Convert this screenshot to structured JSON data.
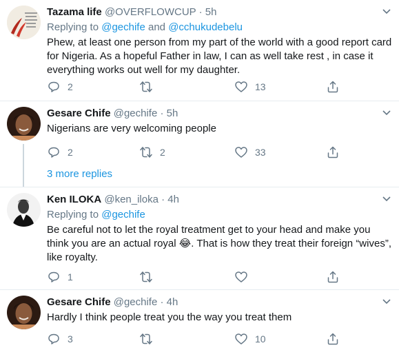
{
  "tweets": [
    {
      "name": "Tazama life",
      "handle": "@OVERFLOWCUP",
      "time": "5h",
      "replying_prefix": "Replying to ",
      "replying_mention_1": "@gechife",
      "replying_and": " and ",
      "replying_mention_2": "@cchukudebelu",
      "text_lines": [
        "Phew, at least one person from my part of the world with a good report card",
        "for Nigeria. As a hopeful Father in law, I can as well take rest , in case  it",
        "everything works out well for my daughter."
      ],
      "replies": "2",
      "retweets": "",
      "likes": "13"
    },
    {
      "name": "Gesare Chife",
      "handle": "@gechife",
      "time": "5h",
      "text_lines": [
        "Nigerians are very welcoming people"
      ],
      "replies": "2",
      "retweets": "2",
      "likes": "33"
    },
    {
      "name": "Ken ILOKA",
      "handle": "@ken_iloka",
      "time": "4h",
      "replying_prefix": "Replying to ",
      "replying_mention_1": "@gechife",
      "text_lines": [
        "Be careful not to let the royal treatment get to your head and make you",
        "think you are an actual royal 😂. That is how they treat their foreign “wives”,",
        "like royalty."
      ],
      "replies": "1",
      "retweets": "",
      "likes": ""
    },
    {
      "name": "Gesare Chife",
      "handle": "@gechife",
      "time": "4h",
      "text_lines": [
        "Hardly I think people treat you the way you treat them"
      ],
      "replies": "3",
      "retweets": "",
      "likes": "10"
    }
  ],
  "more_replies": "3 more replies",
  "separator": " · ",
  "icons": {
    "reply": "reply-icon",
    "retweet": "retweet-icon",
    "like": "heart-icon",
    "share": "share-icon",
    "caret": "chevron-down-icon"
  },
  "colors": {
    "accent": "#1b95e0",
    "muted": "#657786",
    "divider": "#e6ecf0"
  }
}
